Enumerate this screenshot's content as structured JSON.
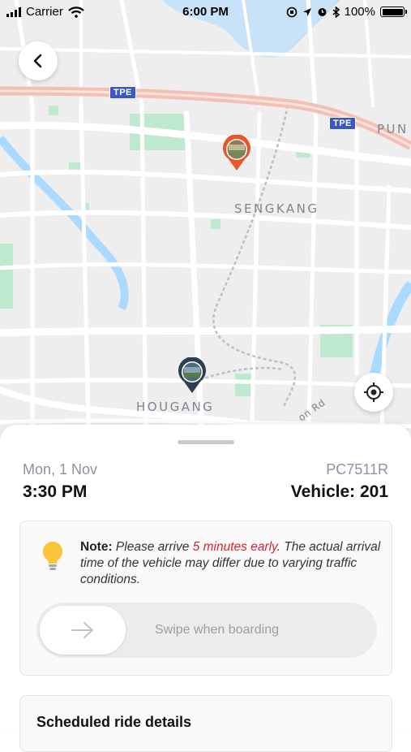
{
  "status_bar": {
    "carrier": "Carrier",
    "time": "6:00 PM",
    "battery": "100%"
  },
  "map": {
    "labels": {
      "sengkang": "SENGKANG",
      "hougang": "HOUGANG",
      "pun": "PUN",
      "road": "on Rd"
    },
    "expressway_shields": [
      "TPE",
      "TPE"
    ],
    "pins": {
      "origin_icon": "orange-pickup-pin-icon",
      "destination_icon": "dark-dropoff-pin-icon"
    },
    "colors": {
      "background": "#eeeeee",
      "park": "#bfe9cf",
      "water": "#aadaff",
      "expressway": "#f4c0b5",
      "pin_orange": "#e8562a",
      "pin_dark": "#2c3e50"
    }
  },
  "ride": {
    "date": "Mon, 1 Nov",
    "time": "3:30 PM",
    "booking_code": "PC7511R",
    "vehicle": "Vehicle: 201"
  },
  "note": {
    "prefix": "Note:",
    "text_before": " Please arrive ",
    "highlight": "5 minutes early",
    "text_after": ". The actual arrival time of the vehicle may differ due to varying traffic conditions.",
    "icon": "lightbulb-icon"
  },
  "swipe": {
    "label": "Swipe when boarding",
    "icon": "arrow-right-icon"
  },
  "details": {
    "title": "Scheduled ride details"
  }
}
